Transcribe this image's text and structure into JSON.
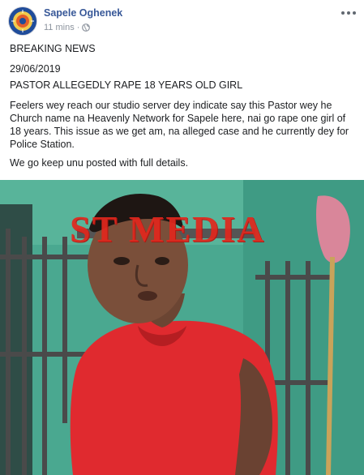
{
  "post": {
    "author": "Sapele Oghenek",
    "timestamp": "11 mins",
    "separator": "·",
    "icons": {
      "avatar": "page-logo",
      "audience": "globe-icon",
      "menu": "more-options-icon"
    },
    "paragraphs": [
      "BREAKING NEWS",
      "29/06/2019",
      "PASTOR ALLEGEDLY RAPE 18 YEARS OLD GIRL",
      "Feelers wey reach our studio server dey indicate say this Pastor wey he Church name na Heavenly Network for Sapele here, nai go rape one girl of 18 years. This issue as we get am, na alleged case and he currently dey for Police Station.",
      "We go keep unu posted with full details."
    ],
    "photo": {
      "watermark": "ST MEDIA"
    }
  },
  "colors": {
    "author_link": "#385898",
    "meta_gray": "#8d949e",
    "wall_green": "#4aa890",
    "shirt_red": "#e02a2f",
    "watermark_red": "#e2271d"
  }
}
